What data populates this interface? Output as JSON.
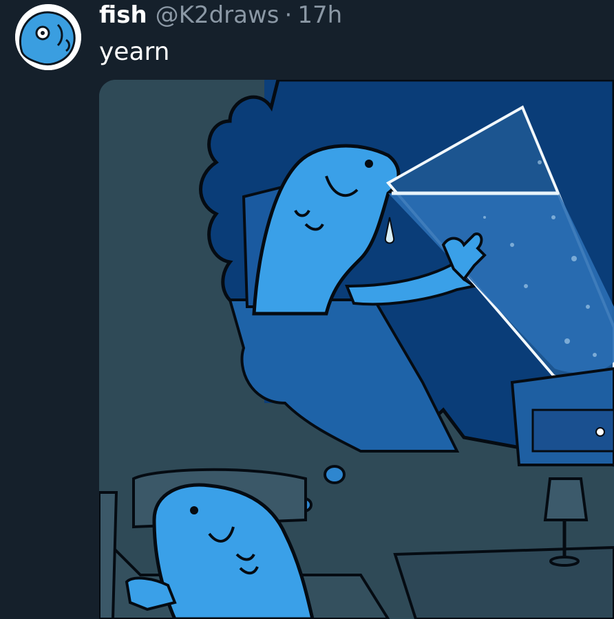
{
  "post": {
    "display_name": "fish",
    "handle": "@K2draws",
    "separator": "·",
    "timestamp": "17h",
    "text": "yearn"
  },
  "media": {
    "description_icon": "comic-illustration"
  },
  "colors": {
    "background": "#15202b",
    "name": "#ffffff",
    "muted": "#8b98a5",
    "fish_blue": "#3a9ee0",
    "dream_blue": "#0c4a8c",
    "room_gray": "#2f4a57"
  }
}
